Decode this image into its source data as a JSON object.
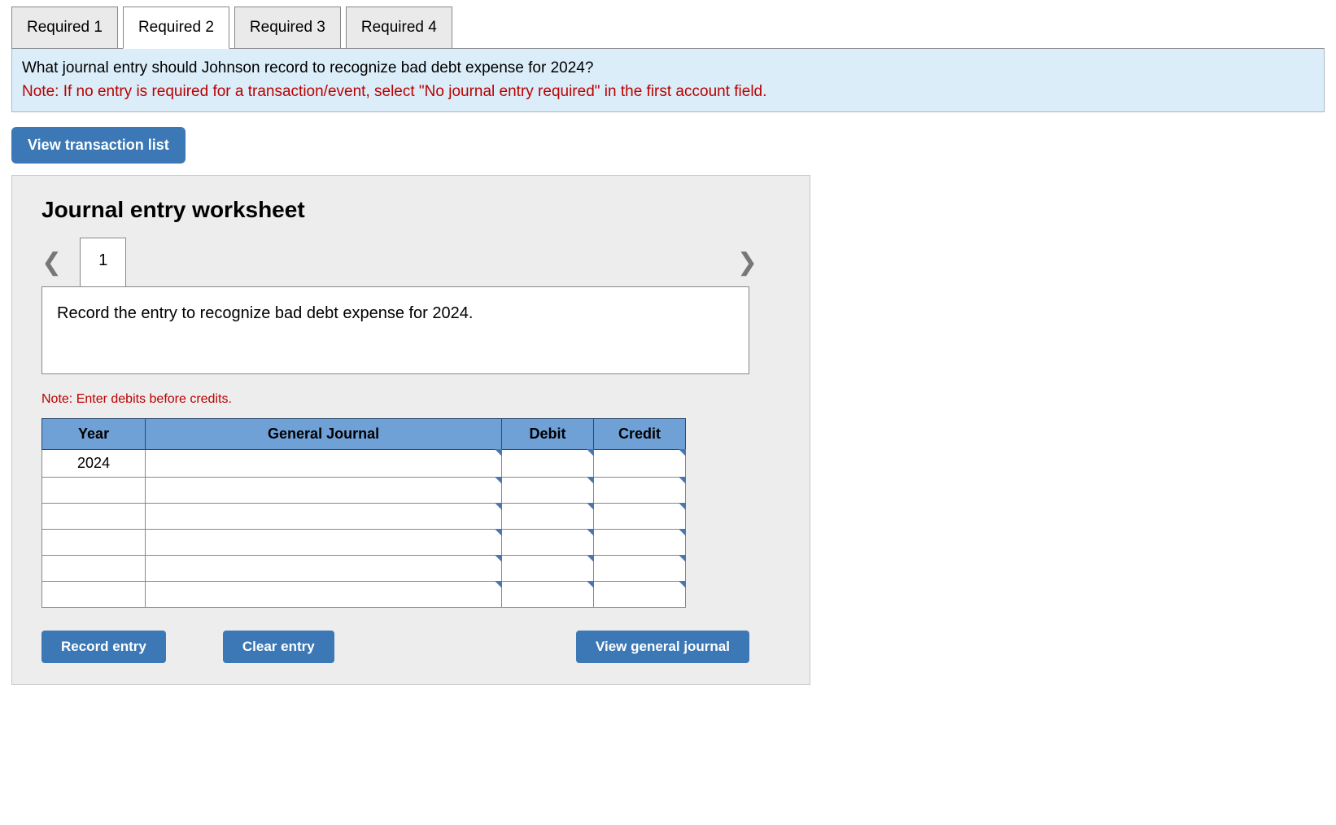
{
  "tabs": [
    {
      "label": "Required 1",
      "active": false
    },
    {
      "label": "Required 2",
      "active": true
    },
    {
      "label": "Required 3",
      "active": false
    },
    {
      "label": "Required 4",
      "active": false
    }
  ],
  "question": {
    "prompt": "What journal entry should Johnson record to recognize bad debt expense for 2024?",
    "note": "Note: If no entry is required for a transaction/event, select \"No journal entry required\" in the first account field."
  },
  "buttons": {
    "view_transaction": "View transaction list",
    "record_entry": "Record entry",
    "clear_entry": "Clear entry",
    "view_general_journal": "View general journal"
  },
  "worksheet": {
    "title": "Journal entry worksheet",
    "page_num": "1",
    "instruction": "Record the entry to recognize bad debt expense for 2024.",
    "debit_note": "Note: Enter debits before credits.",
    "headers": {
      "year": "Year",
      "general_journal": "General Journal",
      "debit": "Debit",
      "credit": "Credit"
    },
    "rows": [
      {
        "year": "2024",
        "gj": "",
        "debit": "",
        "credit": ""
      },
      {
        "year": "",
        "gj": "",
        "debit": "",
        "credit": ""
      },
      {
        "year": "",
        "gj": "",
        "debit": "",
        "credit": ""
      },
      {
        "year": "",
        "gj": "",
        "debit": "",
        "credit": ""
      },
      {
        "year": "",
        "gj": "",
        "debit": "",
        "credit": ""
      },
      {
        "year": "",
        "gj": "",
        "debit": "",
        "credit": ""
      }
    ]
  }
}
